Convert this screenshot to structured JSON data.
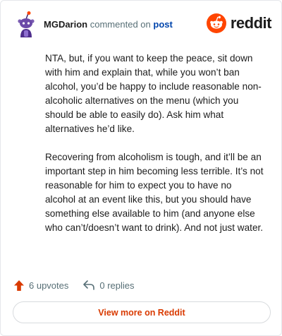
{
  "header": {
    "author": "MGDarion",
    "action": "commented on",
    "post_link": "post",
    "brand": "reddit",
    "avatar_icon": "snoo-avatar-icon",
    "brand_icon": "reddit-logo-icon"
  },
  "comment": {
    "paragraphs": [
      "NTA, but, if you want to keep the peace, sit down with him and explain that, while you won’t ban alcohol, you’d be happy to include reasonable non-alcoholic alternatives on the menu (which you should be able to easily do). Ask him what alternatives he’d like.",
      "Recovering from alcoholism is tough, and it’ll be an important step in him becoming less terrible. It’s not reasonable for him to expect you to have no alcohol at an event like this, but you should have something else available to him (and anyone else who can’t/doesn’t want to drink). And not just water."
    ]
  },
  "stats": {
    "upvotes": "6 upvotes",
    "replies": "0 replies",
    "upvote_icon": "upvote-arrow-icon",
    "reply_icon": "reply-icon"
  },
  "cta": {
    "label": "View more on Reddit"
  },
  "colors": {
    "accent": "#ff4500",
    "link": "#0045ac",
    "cta": "#d93a00",
    "meta": "#576f76"
  }
}
